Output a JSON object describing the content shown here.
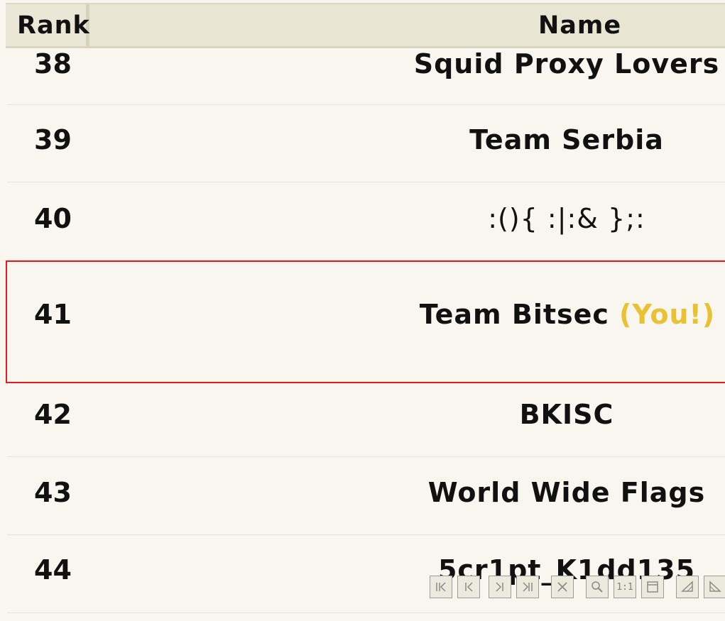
{
  "header": {
    "rank_label": "Rank",
    "name_label": "Name"
  },
  "rows": [
    {
      "rank": "38",
      "name": "Squid Proxy Lovers"
    },
    {
      "rank": "39",
      "name": "Team Serbia"
    },
    {
      "rank": "40",
      "name": ":(){ :|:& };:"
    },
    {
      "rank": "41",
      "name": "Team Bitsec",
      "you_tag": "(You!)"
    },
    {
      "rank": "42",
      "name": "BKISC"
    },
    {
      "rank": "43",
      "name": "World Wide Flags"
    },
    {
      "rank": "44",
      "name": "5cr1pt_K1dd135"
    }
  ],
  "colors": {
    "highlight_border": "#e51c1c",
    "you_tag": "#e9c132",
    "background": "#f8f6ef",
    "header_bg": "#e9e5d3"
  },
  "toolbar": {
    "buttons": [
      "first-page-icon",
      "previous-page-icon",
      "next-page-icon",
      "last-page-icon",
      "close-icon",
      "zoom-icon",
      "actual-size-icon",
      "fit-window-icon",
      "rotate-left-icon",
      "rotate-right-icon"
    ],
    "actual_size_label": "1:1"
  }
}
